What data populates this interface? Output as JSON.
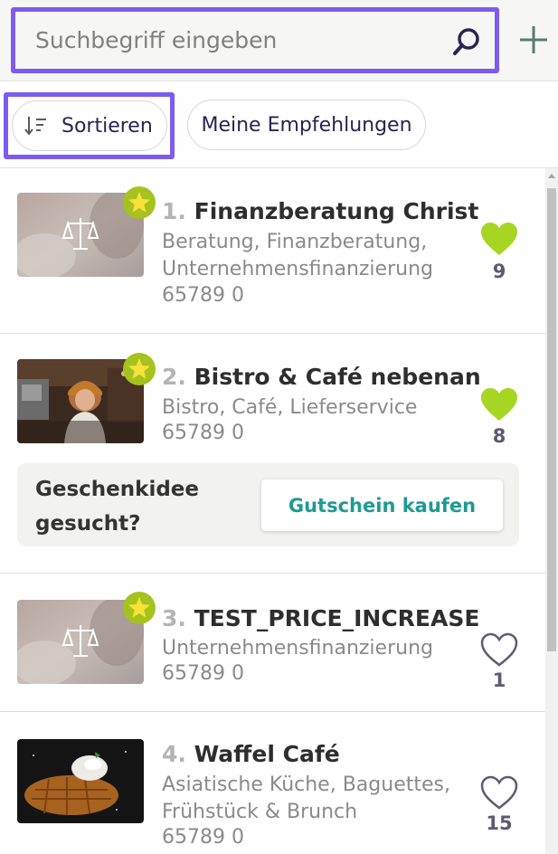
{
  "search": {
    "placeholder": "Suchbegriff eingeben",
    "value": ""
  },
  "filters": {
    "sort_label": "Sortieren",
    "recommendations_label": "Meine Empfehlungen"
  },
  "listings": [
    {
      "rank": "1.",
      "name": "Finanzberatung Christ",
      "categories": "Beratung, Finanzberatung, Unternehmensfinanzierung",
      "zip": "65789 0",
      "likes": "9",
      "liked": true,
      "image": "scales-of-justice-blurred-office",
      "starred": true
    },
    {
      "rank": "2.",
      "name": "Bistro & Café nebenan",
      "categories": "Bistro, Café, Lieferservice",
      "zip": "65789 0",
      "likes": "8",
      "liked": true,
      "image": "barista-woman-cafe",
      "starred": true,
      "gift": {
        "text": "Geschenkidee gesucht?",
        "button": "Gutschein kaufen"
      }
    },
    {
      "rank": "3.",
      "name": "TEST_PRICE_INCREASE",
      "categories": "Unternehmensfinanzierung",
      "zip": "65789 0",
      "likes": "1",
      "liked": false,
      "image": "scales-of-justice-blurred-office",
      "starred": true
    },
    {
      "rank": "4.",
      "name": "Waffel Café",
      "categories": "Asiatische Küche, Baguettes, Frühstück & Brunch",
      "zip": "65789 0",
      "likes": "15",
      "liked": false,
      "image": "waffle-with-ice-cream"
    }
  ],
  "colors": {
    "focus_outline": "#7b5cf0",
    "heart_liked": "#a6d623",
    "heart_outline": "#5d5a72",
    "star_badge": "#a6c21e",
    "gift_button_text": "#1f9a94"
  },
  "icons": {
    "search": "search-icon",
    "add": "plus-icon",
    "sort": "sort-icon",
    "star": "star-badge-icon",
    "heart": "heart-icon"
  }
}
